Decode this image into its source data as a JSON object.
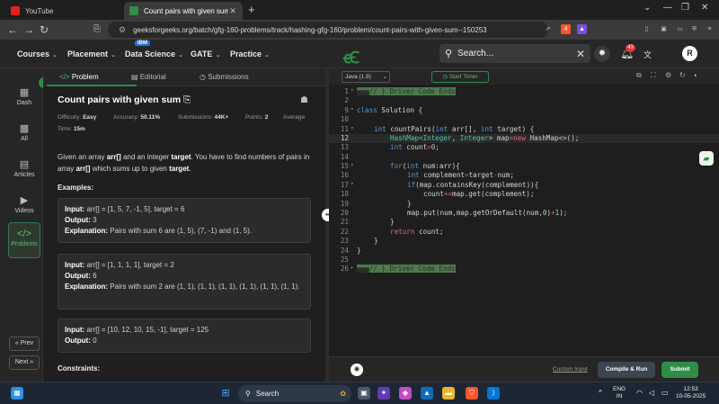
{
  "browser": {
    "tabs": [
      {
        "title": "YouTube",
        "active": false
      },
      {
        "title": "Count pairs with given sum | Pr",
        "active": true
      }
    ],
    "new_tab": "+",
    "url": "geeksforgeeks.org/batch/gfg-160-problems/track/hashing-gfg-160/problem/count-pairs-with-given-sum--150253",
    "ext_badge": "4"
  },
  "header": {
    "menu": [
      {
        "label": "Courses"
      },
      {
        "label": "Placement"
      },
      {
        "label": "Data Science"
      },
      {
        "label": "GATE"
      },
      {
        "label": "Practice"
      }
    ],
    "ibm_badge": "IBM",
    "logo": "ꞓꞒ",
    "search_placeholder": "Search...",
    "notif_count": "43",
    "avatar": "R"
  },
  "rail": {
    "items": [
      {
        "label": "Dash",
        "icon": "dash-icon"
      },
      {
        "label": "All",
        "icon": "grid-icon"
      },
      {
        "label": "Articles",
        "icon": "articles-icon"
      },
      {
        "label": "Videos",
        "icon": "videos-icon"
      },
      {
        "label": "Problems",
        "icon": "code-icon"
      }
    ],
    "prev_label": "« Prev",
    "next_label": "Next »"
  },
  "problem_tabs": [
    {
      "label": "Problem",
      "icon": "</>"
    },
    {
      "label": "Editorial",
      "icon": "▤"
    },
    {
      "label": "Submissions",
      "icon": "◷"
    }
  ],
  "problem": {
    "title": "Count pairs with given sum",
    "difficulty_label": "Difficulty:",
    "difficulty": "Easy",
    "accuracy_label": "Accuracy:",
    "accuracy": "50.11%",
    "submissions_label": "Submissions:",
    "submissions": "44K+",
    "points_label": "Points:",
    "points": "2",
    "average": "Average",
    "time_label": "Time:",
    "time": "15m",
    "desc_1": "Given an array ",
    "desc_arr": "arr[]",
    "desc_2": " and an integer ",
    "desc_target": "target",
    "desc_3": ". You have to find numbers of pairs in array ",
    "desc_arr2": "arr[]",
    "desc_4": " which sums up to given ",
    "desc_target2": "target",
    "desc_5": ".",
    "examples_heading": "Examples:",
    "examples": [
      {
        "input": "arr[] = [1, 5, 7, -1, 5], target = 6",
        "output": "3",
        "explanation": "Pairs with sum 6 are (1, 5), (7, -1) and (1, 5)."
      },
      {
        "input": "arr[] = [1, 1, 1, 1], target = 2",
        "output": "6",
        "explanation": "Pairs with sum 2 are (1, 1), (1, 1), (1, 1), (1, 1), (1, 1), (1, 1)."
      },
      {
        "input": "arr[] = [10, 12, 10, 15, -1], target = 125",
        "output": "0",
        "explanation": ""
      }
    ],
    "input_label": "Input:",
    "output_label": "Output:",
    "explanation_label": "Explanation:",
    "constraints_heading": "Constraints:"
  },
  "editor": {
    "language": "Java (1.8)",
    "timer_label": "Start Timer",
    "lines": [
      {
        "n": "1",
        "fold": true
      },
      {
        "n": "2"
      },
      {
        "n": "9",
        "fold": true
      },
      {
        "n": "10"
      },
      {
        "n": "11",
        "fold": true
      },
      {
        "n": "12"
      },
      {
        "n": "13"
      },
      {
        "n": "14"
      },
      {
        "n": "15",
        "fold": true
      },
      {
        "n": "16"
      },
      {
        "n": "17",
        "fold": true
      },
      {
        "n": "18"
      },
      {
        "n": "19"
      },
      {
        "n": "20"
      },
      {
        "n": "21"
      },
      {
        "n": "22"
      },
      {
        "n": "23"
      },
      {
        "n": "24"
      },
      {
        "n": "25"
      },
      {
        "n": "26",
        "fold": true
      }
    ],
    "code": {
      "l1": "// } Driver Code Ends",
      "l9_kw": "class",
      "l9_rest": " Solution {",
      "l11_kw": "int",
      "l11_name": " countPairs(",
      "l11_kw2": "int",
      "l11_a": " arr[], ",
      "l11_kw3": "int",
      "l11_b": " target) {",
      "l12_t1": "HashMap<",
      "l12_t2": "Integer",
      "l12_t3": ", ",
      "l12_t4": "Integer",
      "l12_t5": "> map",
      "l12_op": "=",
      "l12_new": "new",
      "l12_rest": " HashMap<>();",
      "l13_kw": "int",
      "l13_rest": " count",
      "l13_op": "=",
      "l13_num": "0",
      "l13_end": ";",
      "l15_kw": "for",
      "l15_a": "(",
      "l15_kw2": "int",
      "l15_rest": " num:arr){",
      "l16_kw": "int",
      "l16_rest": " complement",
      "l16_op": "=",
      "l16_rest2": "target",
      "l16_op2": "-",
      "l16_rest3": "num;",
      "l17_kw": "if",
      "l17_rest": "(map.containsKey(complement)){",
      "l18_a": "count",
      "l18_op": "+=",
      "l18_rest": "map.get(complement);",
      "l19": "}",
      "l20_a": "map.put(num,map.getOrDefault(num,",
      "l20_n0": "0",
      "l20_b": ")",
      "l20_op": "+",
      "l20_n1": "1",
      "l20_c": ");",
      "l21": "}",
      "l22_kw": "return",
      "l22_rest": " count;",
      "l23": "}",
      "l24": "}",
      "l26": "// } Driver Code Ends"
    },
    "custom_input": "Custom Input",
    "compile_run": "Compile & Run",
    "submit": "Submit"
  },
  "taskbar": {
    "search": "Search",
    "lang": "ENG",
    "region": "IN",
    "time": "12:53",
    "date": "10-05-2025"
  }
}
